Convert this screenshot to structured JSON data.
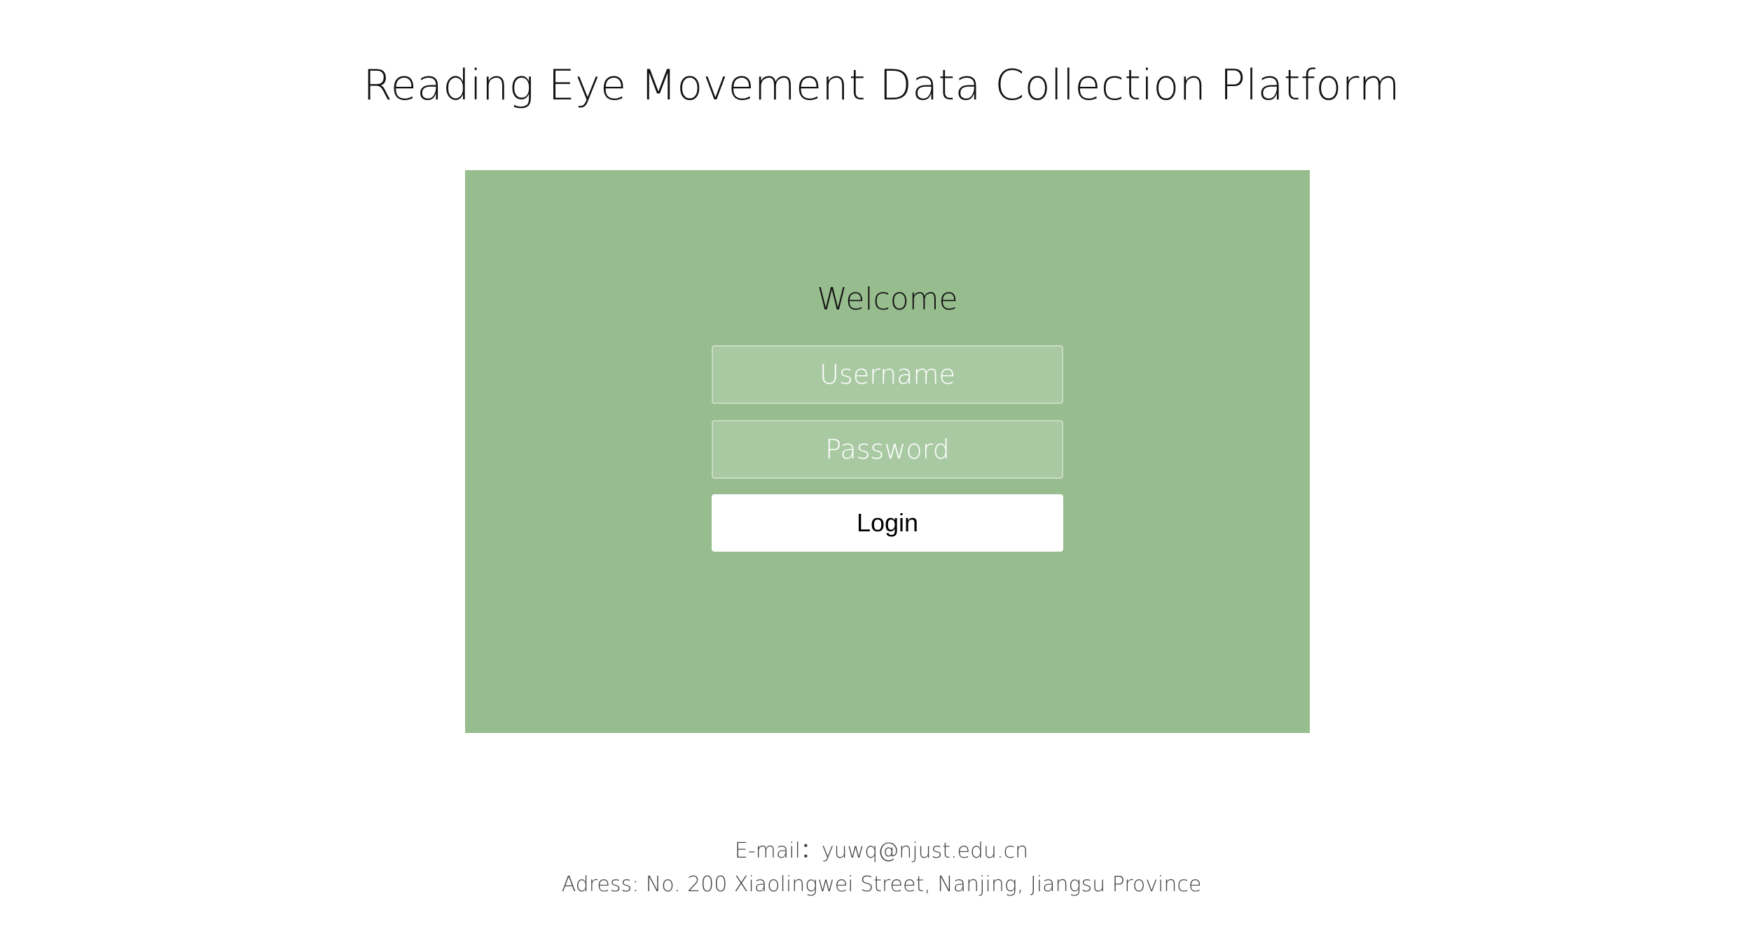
{
  "header": {
    "title": "Reading Eye Movement Data Collection Platform"
  },
  "login": {
    "welcome": "Welcome",
    "username_placeholder": "Username",
    "password_placeholder": "Password",
    "login_label": "Login",
    "panel_color": "#97bc8e"
  },
  "footer": {
    "email_line": "E-mail：yuwq@njust.edu.cn",
    "address_line": "Adress: No. 200 Xiaolingwei Street, Nanjing, Jiangsu Province"
  }
}
